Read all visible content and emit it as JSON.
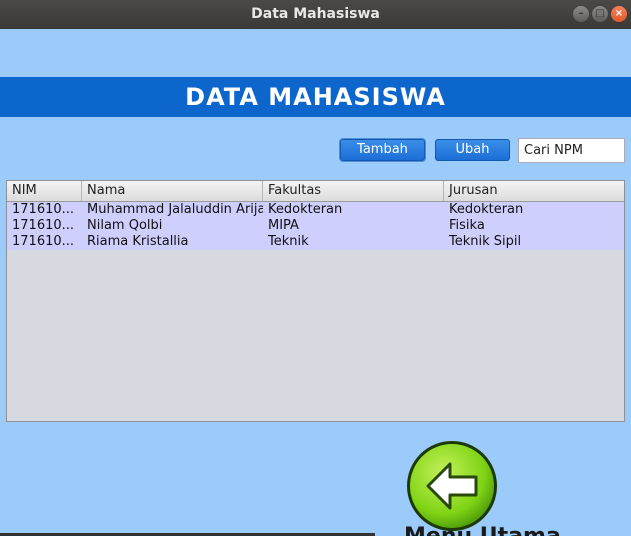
{
  "window": {
    "title": "Data Mahasiswa"
  },
  "header": {
    "title": "DATA MAHASISWA"
  },
  "toolbar": {
    "add_label": "Tambah",
    "edit_label": "Ubah",
    "search_value": "Cari NPM"
  },
  "table": {
    "columns": [
      "NIM",
      "Nama",
      "Fakultas",
      "Jurusan"
    ],
    "rows": [
      [
        "171610...",
        "Muhammad Jalaluddin Arija",
        "Kedokteran",
        "Kedokteran"
      ],
      [
        "171610...",
        "Nilam Qolbi",
        "MIPA",
        "Fisika"
      ],
      [
        "171610...",
        "Riama Kristallia",
        "Teknik",
        "Teknik Sipil"
      ]
    ]
  },
  "footer": {
    "partial_label": "Menu Utama"
  },
  "colors": {
    "background": "#9acbfb",
    "banner": "#0c66cc",
    "button": "#1c6ed6",
    "row_highlight": "#cfcffe"
  }
}
